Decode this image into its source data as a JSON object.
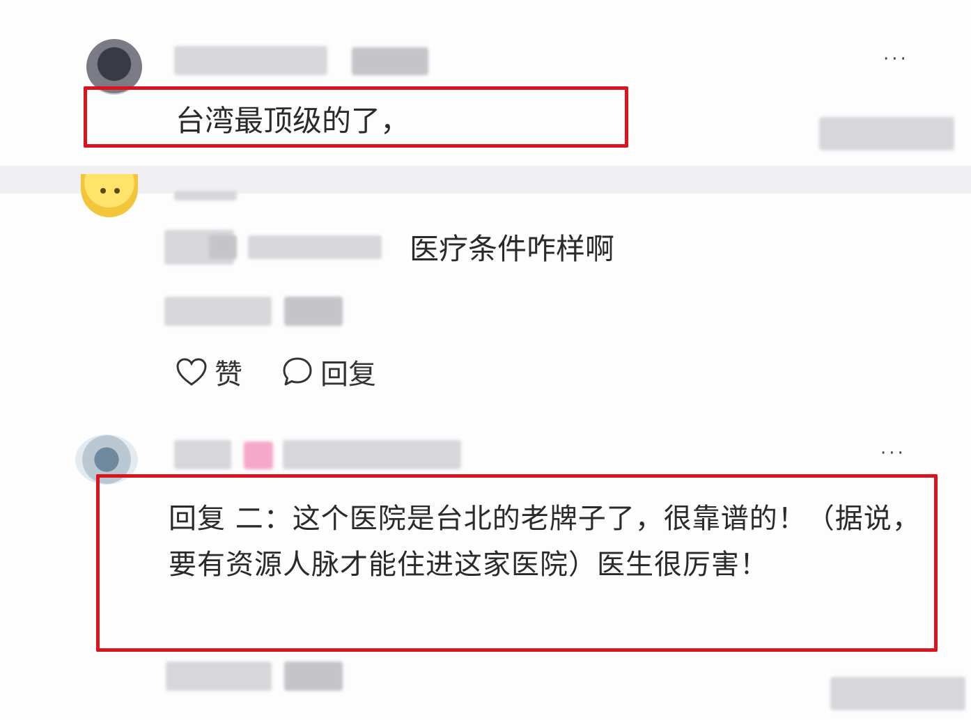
{
  "comments": [
    {
      "text": "台湾最顶级的了，"
    },
    {
      "question": "医疗条件咋样啊",
      "actions": {
        "like_label": "赞",
        "reply_label": "回复"
      }
    },
    {
      "reply_text": "回复 二：这个医院是台北的老牌子了，很靠谱的！（据说，要有资源人脉才能住进这家医院）医生很厉害！"
    }
  ],
  "more_label": "···",
  "colors": {
    "highlight": "#d9141e",
    "text": "#2a2a2a"
  },
  "icons": [
    "heart-icon",
    "comment-bubble-icon",
    "more-dots-icon"
  ]
}
